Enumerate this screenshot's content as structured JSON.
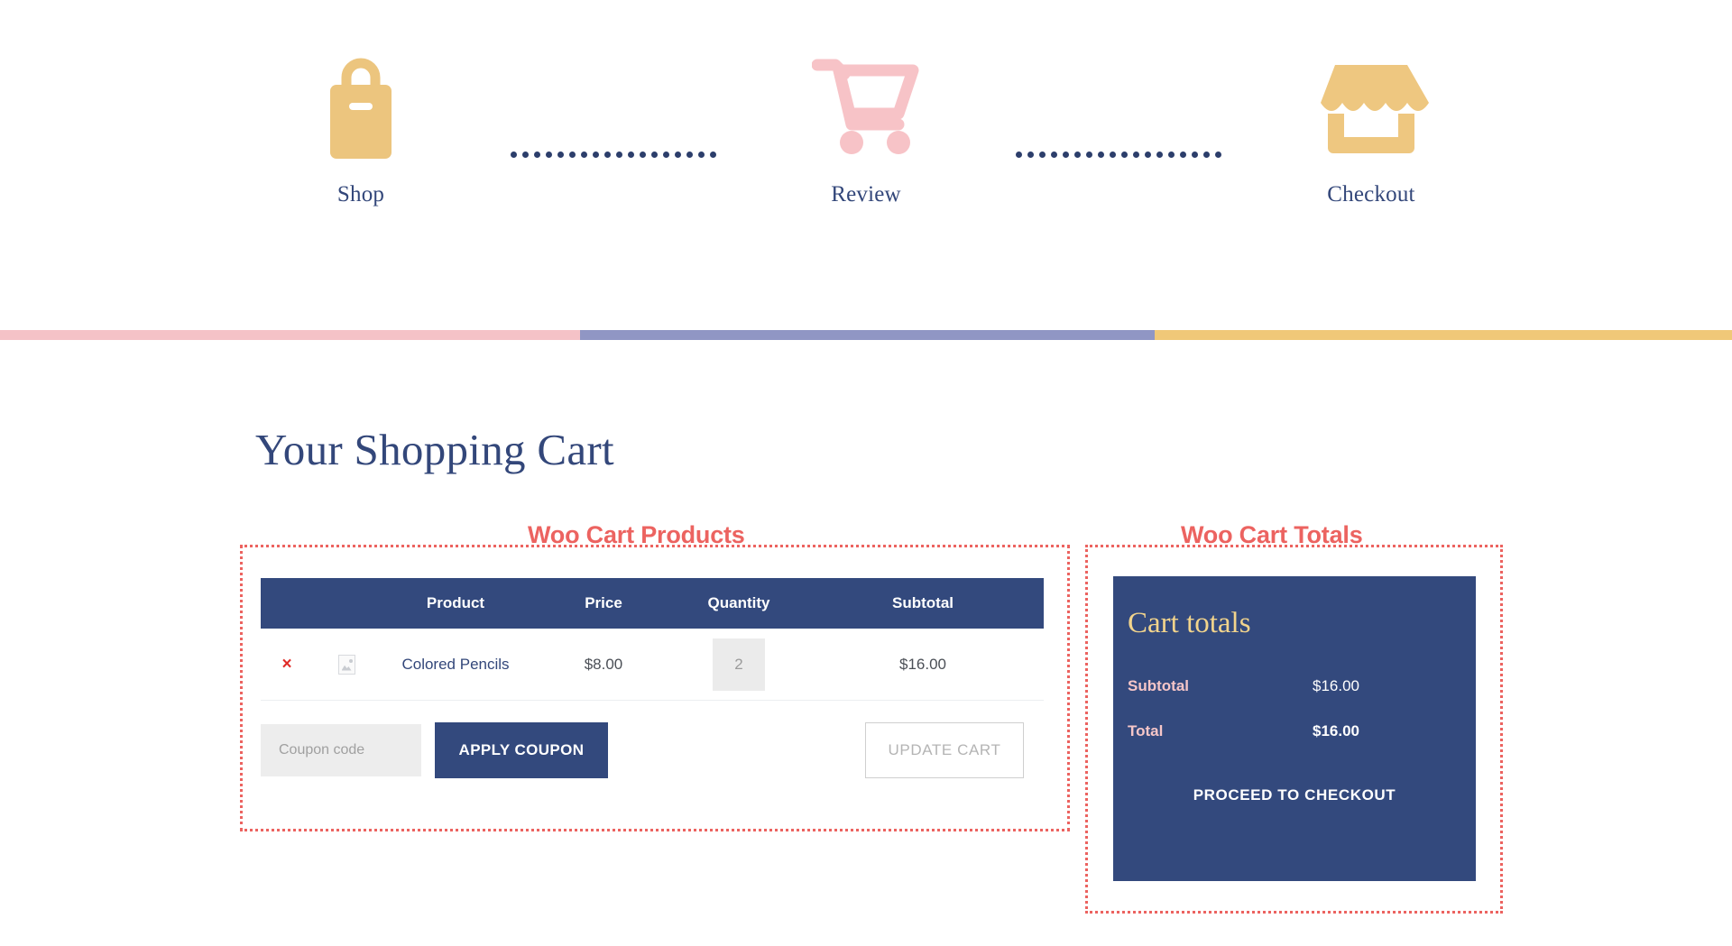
{
  "steps": [
    {
      "label": "Shop",
      "icon": "shopping-bag-icon",
      "color": "#ecc57e"
    },
    {
      "label": "Review",
      "icon": "shopping-cart-icon",
      "color": "#f7c3c7"
    },
    {
      "label": "Checkout",
      "icon": "storefront-icon",
      "color": "#eec780"
    }
  ],
  "progress_bar": {
    "segments": [
      {
        "name": "pink",
        "color": "#f5c2c7"
      },
      {
        "name": "purple",
        "color": "#9096c4"
      },
      {
        "name": "gold",
        "color": "#f0c878"
      }
    ]
  },
  "page_title": "Your Shopping Cart",
  "annotations": {
    "products": "Woo Cart Products",
    "totals": "Woo Cart Totals",
    "color": "#ec6360"
  },
  "cart_table": {
    "headers": {
      "remove": "",
      "thumb": "",
      "product": "Product",
      "price": "Price",
      "quantity": "Quantity",
      "subtotal": "Subtotal"
    },
    "rows": [
      {
        "remove_label": "×",
        "thumb": "image-placeholder-icon",
        "product": "Colored Pencils",
        "price": "$8.00",
        "quantity": "2",
        "subtotal": "$16.00"
      }
    ],
    "coupon": {
      "value": "",
      "placeholder": "Coupon code",
      "apply_label": "APPLY COUPON"
    },
    "update_label": "UPDATE CART"
  },
  "cart_totals": {
    "title": "Cart totals",
    "rows": [
      {
        "label": "Subtotal",
        "value": "$16.00",
        "bold": false
      },
      {
        "label": "Total",
        "value": "$16.00",
        "bold": true
      }
    ],
    "checkout_label": "PROCEED TO CHECKOUT",
    "panel_color": "#33497d",
    "title_color": "#f2d48c",
    "label_color": "#f6c6c8"
  }
}
